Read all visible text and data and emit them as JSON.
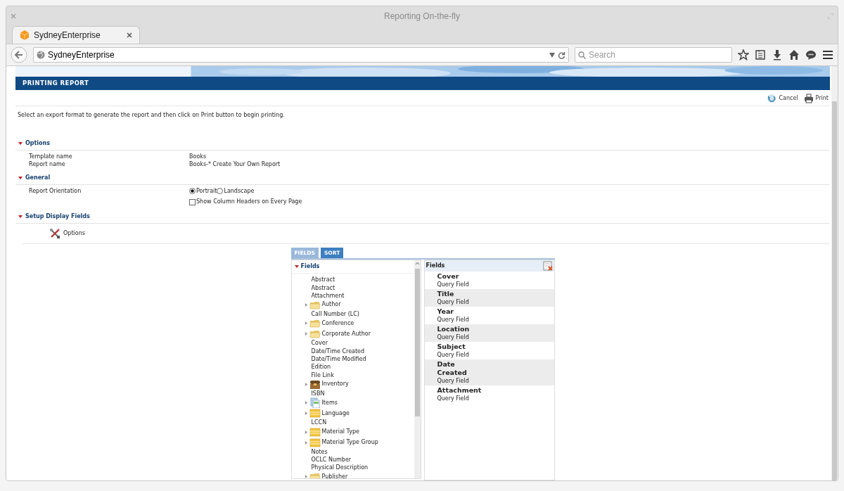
{
  "window": {
    "title": "Reporting On-the-fly"
  },
  "tabs": [
    {
      "label": "SydneyEnterprise",
      "selected": true
    }
  ],
  "address_bar": {
    "value": "SydneyEnterprise"
  },
  "search": {
    "placeholder": "Search"
  },
  "page": {
    "header": "PRINTING REPORT",
    "actions": [
      {
        "kind": "cancel",
        "label": "Cancel"
      },
      {
        "kind": "print",
        "label": "Print"
      }
    ],
    "instruction": "Select an export format to generate the report and then click on Print button to begin printing.",
    "sections": [
      {
        "kind": "info",
        "title": "Options",
        "expanded": true,
        "rows": [
          {
            "label": "Template name",
            "value": "Books"
          },
          {
            "label": "Report name",
            "value": "Books-* Create Your Own Report"
          }
        ]
      },
      {
        "kind": "orientation",
        "title": "General",
        "expanded": true,
        "label": "Report Orientation",
        "options": [
          {
            "label": "Portrait",
            "selected": true
          },
          {
            "label": "Landscape",
            "selected": false
          }
        ],
        "checkbox": {
          "label": "Show Column Headers on Every Page",
          "checked": false
        }
      },
      {
        "kind": "fields",
        "title": "Setup Display Fields",
        "expanded": true,
        "link": "Options"
      }
    ],
    "field_tabs": [
      {
        "label": "FIELDS",
        "selected": true
      },
      {
        "label": "SORT",
        "selected": false
      }
    ],
    "field_tree": {
      "title": "Fields",
      "expanded": true,
      "items": [
        {
          "kind": "leaf",
          "label": "Abstract"
        },
        {
          "kind": "leaf",
          "label": "Abstract"
        },
        {
          "kind": "leaf",
          "label": "Attachment"
        },
        {
          "kind": "folder",
          "label": "Author",
          "expanded": false
        },
        {
          "kind": "leaf",
          "label": "Call Number (LC)"
        },
        {
          "kind": "folder",
          "label": "Conference",
          "expanded": false
        },
        {
          "kind": "folder",
          "label": "Corporate Author",
          "expanded": false
        },
        {
          "kind": "leaf",
          "label": "Cover"
        },
        {
          "kind": "leaf",
          "label": "Date/Time Created"
        },
        {
          "kind": "leaf",
          "label": "Date/Time Modified"
        },
        {
          "kind": "leaf",
          "label": "Edition"
        },
        {
          "kind": "leaf",
          "label": "File Link"
        },
        {
          "kind": "chest",
          "label": "Inventory",
          "expanded": false
        },
        {
          "kind": "leaf",
          "label": "ISBN"
        },
        {
          "kind": "pages",
          "label": "Items",
          "expanded": false
        },
        {
          "kind": "table",
          "label": "Language",
          "expanded": false
        },
        {
          "kind": "leaf",
          "label": "LCCN"
        },
        {
          "kind": "table",
          "label": "Material Type",
          "expanded": false
        },
        {
          "kind": "table",
          "label": "Material Type Group",
          "expanded": false
        },
        {
          "kind": "leaf",
          "label": "Notes"
        },
        {
          "kind": "leaf",
          "label": "OCLC Number"
        },
        {
          "kind": "leaf",
          "label": "Physical Description"
        },
        {
          "kind": "folder",
          "label": "Publisher",
          "expanded": false
        }
      ]
    },
    "selected_fields": {
      "title": "Fields",
      "items": [
        {
          "name": "Cover",
          "type": "Query Field"
        },
        {
          "name": "Title",
          "type": "Query Field"
        },
        {
          "name": "Year",
          "type": "Query Field"
        },
        {
          "name": "Location",
          "type": "Query Field"
        },
        {
          "name": "Subject",
          "type": "Query Field"
        },
        {
          "name": "Date Created",
          "type": "Query Field"
        },
        {
          "name": "Attachment",
          "type": "Query Field"
        }
      ]
    }
  }
}
